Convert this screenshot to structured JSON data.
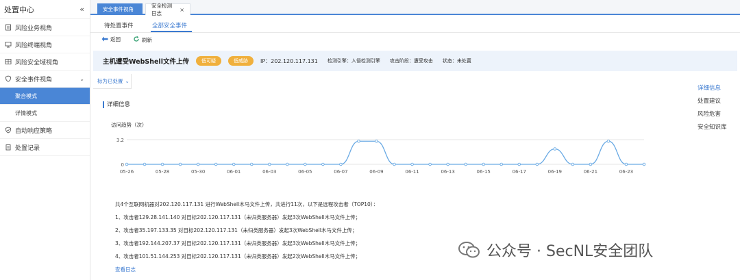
{
  "sidebar": {
    "title": "处置中心",
    "collapse_icon": "«",
    "items": [
      {
        "icon": "doc-icon",
        "label": "风险业务视角"
      },
      {
        "icon": "monitor-icon",
        "label": "风险终端视角"
      },
      {
        "icon": "grid-icon",
        "label": "风险安全域视角"
      },
      {
        "icon": "shield-icon",
        "label": "安全事件视角"
      },
      {
        "icon": "shield-check-icon",
        "label": "自动响应策略"
      },
      {
        "icon": "clipboard-icon",
        "label": "处置记录"
      }
    ],
    "sub_items": [
      {
        "label": "聚合模式",
        "active": true
      },
      {
        "label": "详情模式",
        "active": false
      }
    ]
  },
  "top_tabs": [
    {
      "label": "安全事件视角",
      "active": true
    },
    {
      "label": "安全检测日志",
      "active": false,
      "close": "×"
    }
  ],
  "sub_tabs": [
    {
      "label": "待处置事件"
    },
    {
      "label": "全部安全事件"
    }
  ],
  "toolbar": {
    "back_label": "返回",
    "refresh_label": "刷新"
  },
  "event": {
    "title": "主机遭受WebShell文件上传",
    "tags": [
      "低可疑",
      "低威胁"
    ],
    "ip": "IP：202.120.117.131",
    "engine": "检测引擎：入侵检测引擎",
    "stage": "攻击阶段：遭受攻击",
    "status": "状态：未处置"
  },
  "mark_label": "标为已处置",
  "section_title": "详细信息",
  "anchor_nav": [
    "详细信息",
    "处置建议",
    "风险危害",
    "安全知识库"
  ],
  "chart_data": {
    "type": "line",
    "title": "访问趋势（次）",
    "x": [
      "05-26",
      "05-27",
      "05-28",
      "05-29",
      "05-30",
      "05-31",
      "06-01",
      "06-02",
      "06-03",
      "06-04",
      "06-05",
      "06-06",
      "06-07",
      "06-08",
      "06-09",
      "06-10",
      "06-11",
      "06-12",
      "06-13",
      "06-14",
      "06-15",
      "06-16",
      "06-17",
      "06-18",
      "06-19",
      "06-20",
      "06-21",
      "06-22",
      "06-23",
      "06-24"
    ],
    "tick_labels": [
      "05-26",
      "05-28",
      "05-30",
      "06-01",
      "06-03",
      "06-05",
      "06-07",
      "06-09",
      "06-11",
      "06-13",
      "06-15",
      "06-17",
      "06-19",
      "06-21",
      "06-23"
    ],
    "values": [
      0,
      0,
      0,
      0,
      0,
      0,
      0,
      0,
      0,
      0,
      0,
      0,
      0,
      3,
      3,
      0,
      0,
      0,
      0,
      0,
      0,
      0,
      0,
      0,
      2,
      0,
      0,
      3,
      0,
      0
    ],
    "y_ticks": [
      "3.2",
      "0"
    ],
    "ylim": [
      0,
      3.2
    ],
    "color": "#6aaae4",
    "grid": true
  },
  "summary": {
    "intro": "共4个互联网机器对202.120.117.131 进行WebShell木马文件上传，共进行11次，以下是远程攻击者（TOP10）：",
    "lines": [
      "1、攻击者129.28.141.140 对目标202.120.117.131（未归类服务器）发起3次WebShell木马文件上传；",
      "2、攻击者35.197.133.35 对目标202.120.117.131（未归类服务器）发起3次WebShell木马文件上传；",
      "3、攻击者192.144.207.37 对目标202.120.117.131（未归类服务器）发起3次WebShell木马文件上传；",
      "4、攻击者101.51.144.253 对目标202.120.117.131（未归类服务器）发起2次WebShell木马文件上传；"
    ],
    "link": "查看日志"
  },
  "watermark": "公众号 · SecNL安全团队"
}
